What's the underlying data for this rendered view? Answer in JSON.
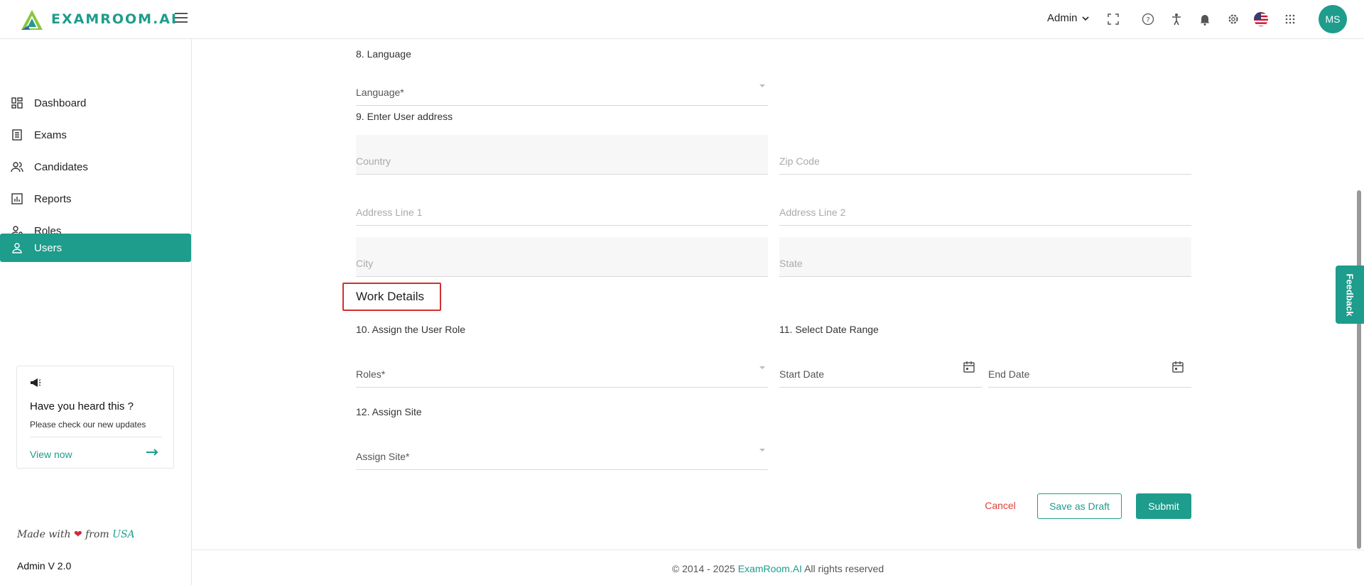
{
  "app": {
    "logo_text": "EXAMROOM.AI",
    "brand_color": "#1e9c8c",
    "user_menu_label": "Admin",
    "avatar_initials": "MS"
  },
  "header_icons": [
    "fullscreen-icon",
    "help-icon",
    "accessibility-icon",
    "bell-icon",
    "gear-icon",
    "us-flag-icon",
    "apps-grid-icon"
  ],
  "sidebar": {
    "items": [
      {
        "label": "Dashboard",
        "icon": "dashboard-icon"
      },
      {
        "label": "Exams",
        "icon": "exams-icon"
      },
      {
        "label": "Candidates",
        "icon": "candidates-icon"
      },
      {
        "label": "Reports",
        "icon": "reports-icon"
      },
      {
        "label": "Roles",
        "icon": "roles-icon"
      },
      {
        "label": "Users",
        "icon": "users-icon"
      }
    ],
    "active_item": "Users",
    "promo": {
      "title": "Have you heard this ?",
      "subtitle": "Please check our new updates",
      "link": "View now"
    },
    "made_with_prefix": "Made with",
    "made_with_from": "from",
    "made_with_country": "USA",
    "version": "Admin V 2.0"
  },
  "form": {
    "language_section": "8. Language",
    "language_placeholder": "Language*",
    "address_section": "9. Enter User address",
    "country_placeholder": "Country",
    "zip_placeholder": "Zip Code",
    "address1_placeholder": "Address Line 1",
    "address2_placeholder": "Address Line 2",
    "city_placeholder": "City",
    "state_placeholder": "State",
    "work_details_title": "Work Details",
    "role_section": "10. Assign the User Role",
    "roles_placeholder": "Roles*",
    "date_section": "11. Select Date Range",
    "start_date_placeholder": "Start Date",
    "end_date_placeholder": "End Date",
    "site_section": "12. Assign Site",
    "site_placeholder": "Assign Site*"
  },
  "actions": {
    "cancel": "Cancel",
    "save_draft": "Save as Draft",
    "submit": "Submit"
  },
  "footer": {
    "prefix": "© 2014 - 2025",
    "brand": "ExamRoom.AI",
    "suffix": "All rights reserved"
  },
  "feedback_tab": "Feedback"
}
